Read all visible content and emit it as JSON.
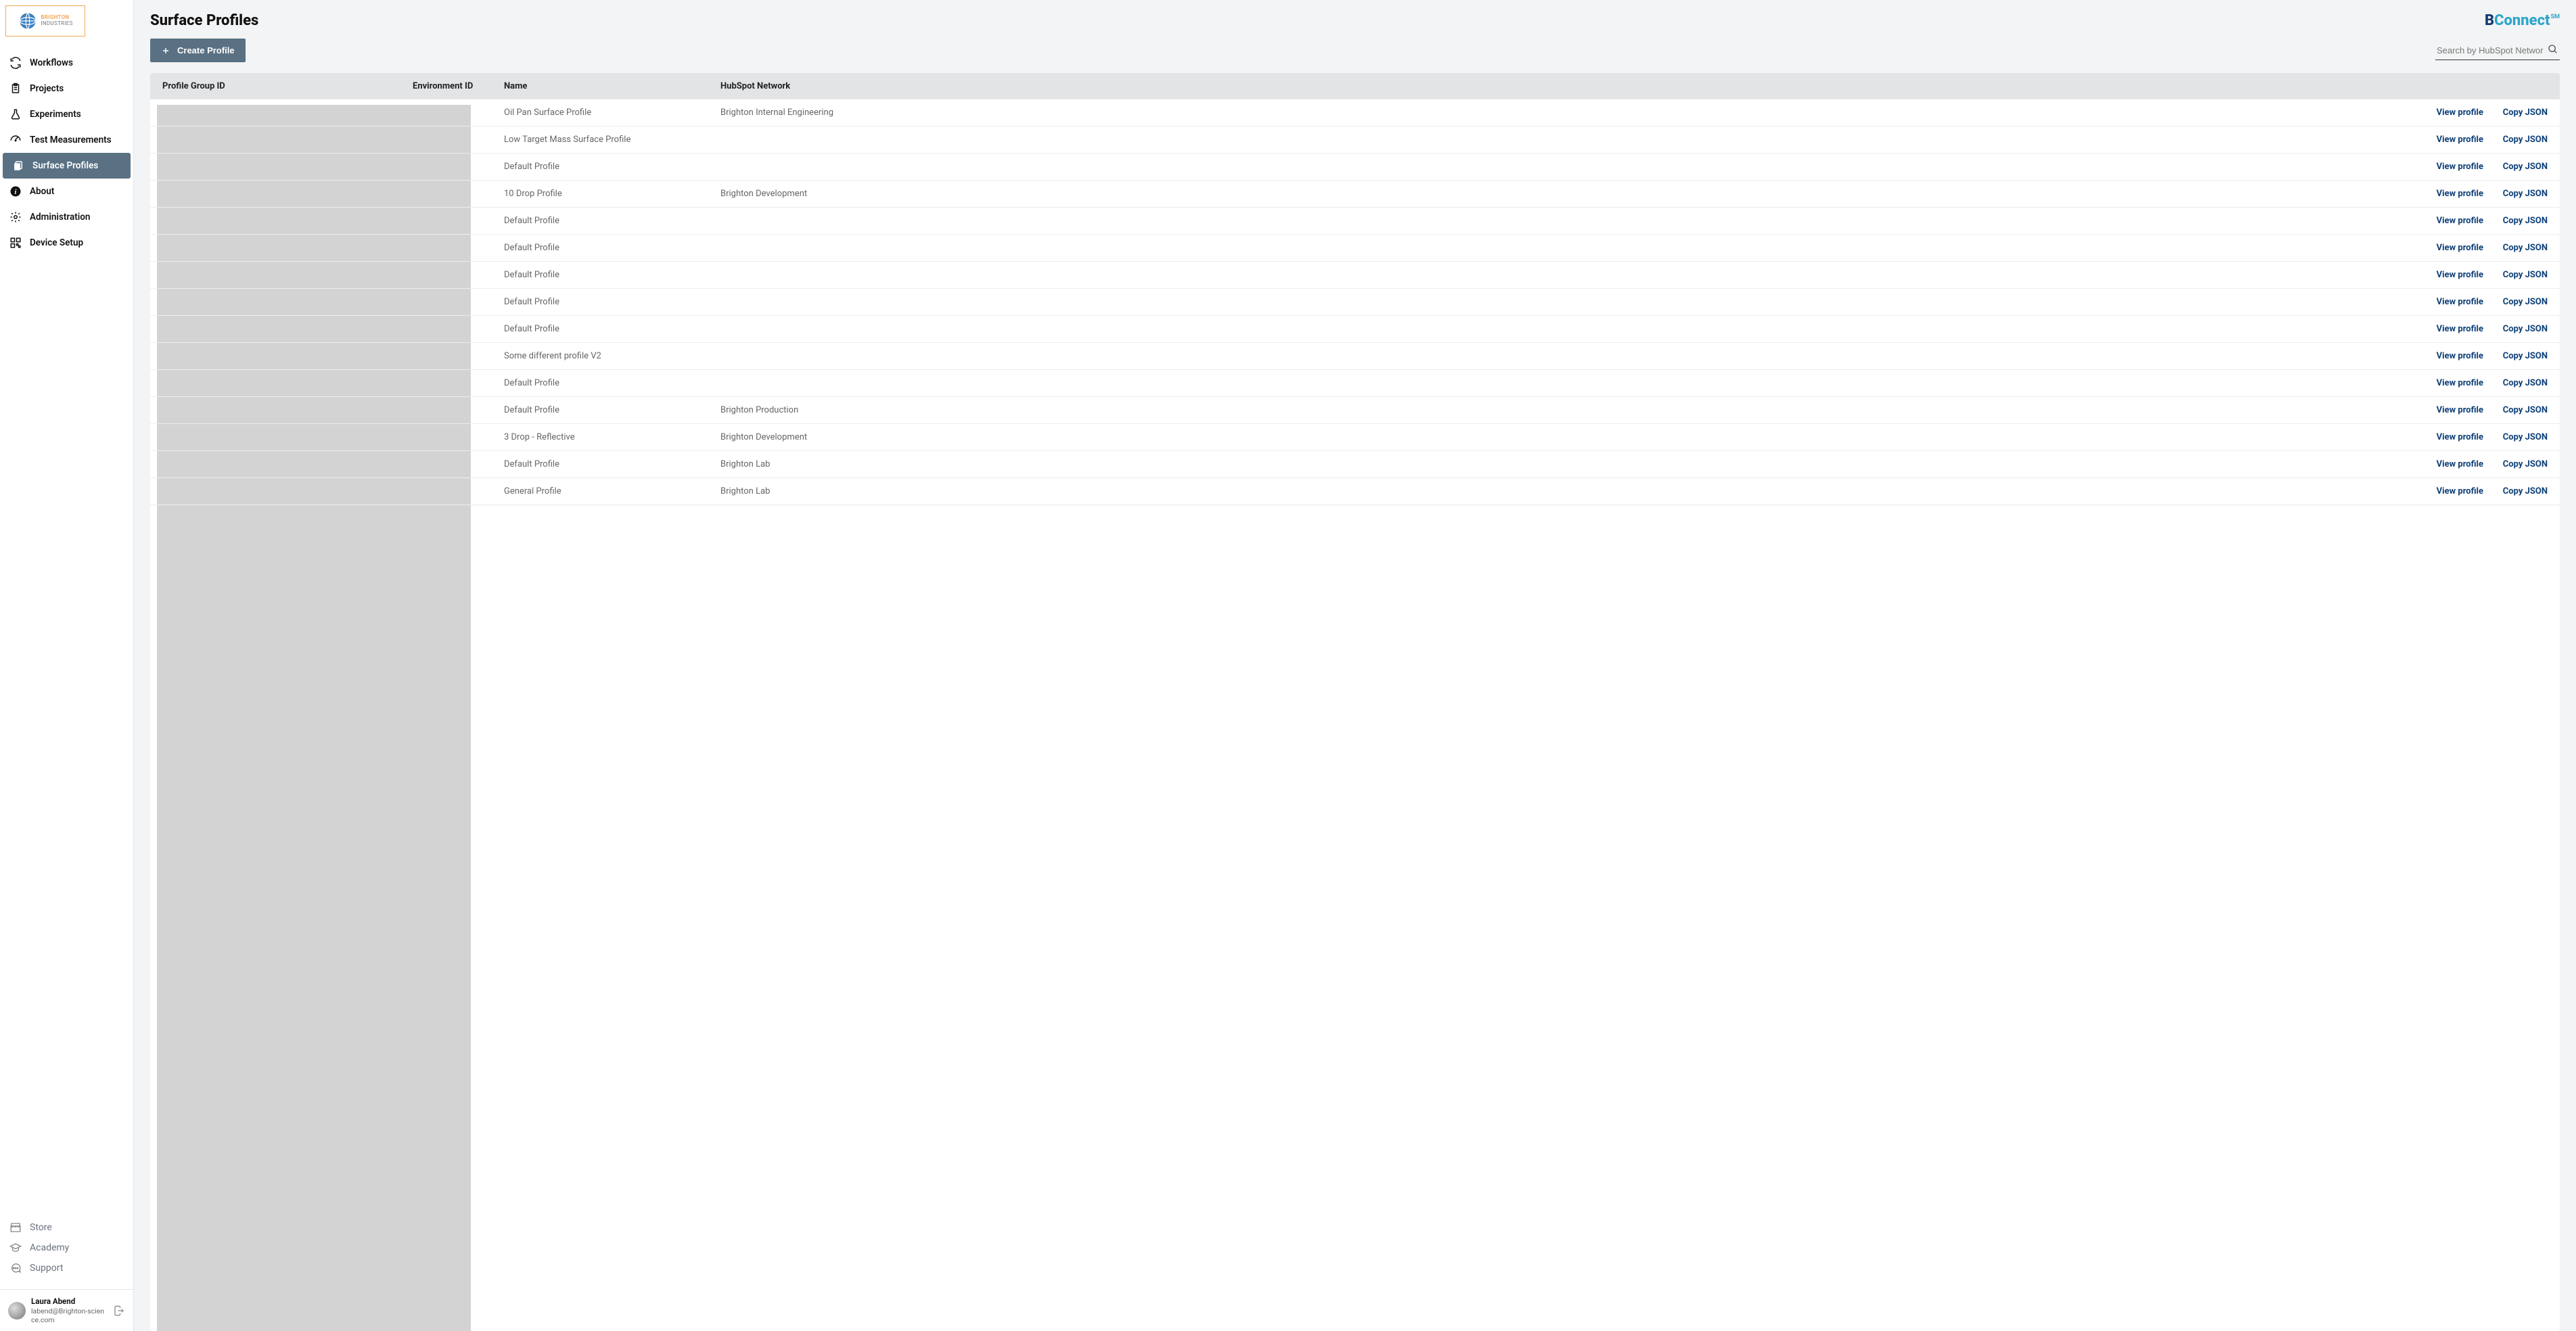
{
  "logo": {
    "line1": "BRIGHTON",
    "line2": "INDUSTRIES"
  },
  "sidebar": {
    "items": [
      {
        "label": "Workflows",
        "icon": "sync-icon"
      },
      {
        "label": "Projects",
        "icon": "clipboard-icon"
      },
      {
        "label": "Experiments",
        "icon": "flask-icon"
      },
      {
        "label": "Test Measurements",
        "icon": "gauge-icon"
      },
      {
        "label": "Surface Profiles",
        "icon": "copy-icon"
      },
      {
        "label": "About",
        "icon": "info-icon"
      },
      {
        "label": "Administration",
        "icon": "gear-icon"
      },
      {
        "label": "Device Setup",
        "icon": "qr-icon"
      }
    ],
    "bottom": [
      {
        "label": "Store",
        "icon": "store-icon"
      },
      {
        "label": "Academy",
        "icon": "academy-icon"
      },
      {
        "label": "Support",
        "icon": "chat-icon"
      }
    ]
  },
  "user": {
    "name": "Laura Abend",
    "email": "labend@Brighton-science.com"
  },
  "page": {
    "title": "Surface Profiles"
  },
  "brand": {
    "b": "B",
    "connect": "Connect",
    "sm": "SM"
  },
  "toolbar": {
    "create_label": "Create Profile"
  },
  "search": {
    "placeholder": "Search by HubSpot Network"
  },
  "table": {
    "columns": {
      "group": "Profile Group ID",
      "env": "Environment ID",
      "name": "Name",
      "network": "HubSpot Network"
    },
    "actions": {
      "view": "View profile",
      "copy": "Copy JSON"
    },
    "rows": [
      {
        "name": "Oil Pan Surface Profile",
        "network": "Brighton Internal Engineering"
      },
      {
        "name": "Low Target Mass Surface Profile",
        "network": ""
      },
      {
        "name": "Default Profile",
        "network": ""
      },
      {
        "name": "10 Drop Profile",
        "network": "Brighton Development"
      },
      {
        "name": "Default Profile",
        "network": ""
      },
      {
        "name": "Default Profile",
        "network": ""
      },
      {
        "name": "Default Profile",
        "network": ""
      },
      {
        "name": "Default Profile",
        "network": ""
      },
      {
        "name": "Default Profile",
        "network": ""
      },
      {
        "name": "Some different profile V2",
        "network": ""
      },
      {
        "name": "Default Profile",
        "network": ""
      },
      {
        "name": "Default Profile",
        "network": "Brighton Production"
      },
      {
        "name": "3 Drop - Reflective",
        "network": "Brighton Development"
      },
      {
        "name": "Default Profile",
        "network": "Brighton Lab"
      },
      {
        "name": "General Profile",
        "network": "Brighton Lab"
      }
    ]
  }
}
